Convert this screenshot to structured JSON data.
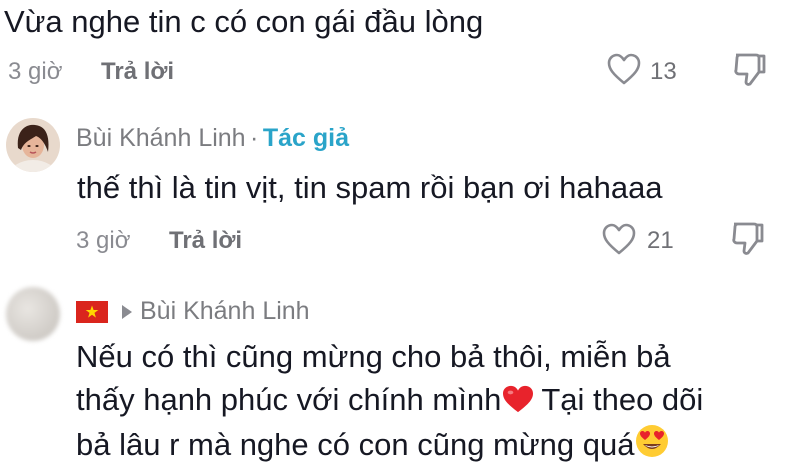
{
  "comments": [
    {
      "text": "Vừa nghe tin c có con gái đầu lòng",
      "time": "3 giờ",
      "reply_label": "Trả lời",
      "likes": "13"
    },
    {
      "author": "Bùi Khánh Linh",
      "separator": "·",
      "author_badge": "Tác giả",
      "text": "thế thì là tin vịt, tin spam rồi bạn ơi hahaaa",
      "time": "3 giờ",
      "reply_label": "Trả lời",
      "likes": "21"
    },
    {
      "reply_to": "Bùi Khánh Linh",
      "lines": [
        "Nếu có thì cũng mừng cho bả thôi, miễn bả",
        "thấy hạnh phúc với chính mình",
        "Tại theo dõi",
        "bả lâu r mà nghe có con cũng mừng quá"
      ]
    }
  ],
  "colors": {
    "author_badge": "#2aa4c9",
    "heart_emoji": "#e8232c",
    "flag": "#da251d",
    "muted": "#8a8b91"
  },
  "icons": [
    "heart-outline-icon",
    "thumbs-down-icon",
    "caret-right-icon",
    "vietnam-flag-icon",
    "red-heart-emoji",
    "heart-eyes-emoji"
  ]
}
